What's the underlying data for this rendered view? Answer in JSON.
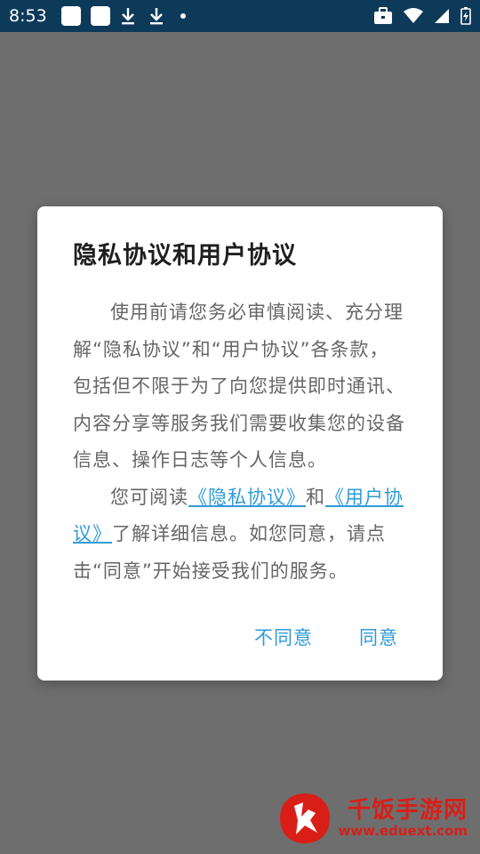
{
  "status_bar": {
    "time": "8:53"
  },
  "dialog": {
    "title": "隐私协议和用户协议",
    "para1": "使用前请您务必审慎阅读、充分理解“隐私协议”和“用户协议”各条款，包括但不限于为了向您提供即时通讯、内容分享等服务我们需要收集您的设备信息、操作日志等个人信息。",
    "para2_prefix": "您可阅读",
    "privacy_link": "《隐私协议》",
    "para2_and": "和",
    "user_link": "《用户协议》",
    "para2_suffix": "了解详细信息。如您同意，请点击“同意”开始接受我们的服务。",
    "disagree_label": "不同意",
    "agree_label": "同意"
  },
  "watermark": {
    "title": "千饭手游网",
    "url": "www.eduext.com"
  },
  "colors": {
    "status_bar": "#0e3a5a",
    "overlay": "#6e6e6e",
    "accent": "#2f9bd8",
    "watermark": "#d91e18"
  }
}
